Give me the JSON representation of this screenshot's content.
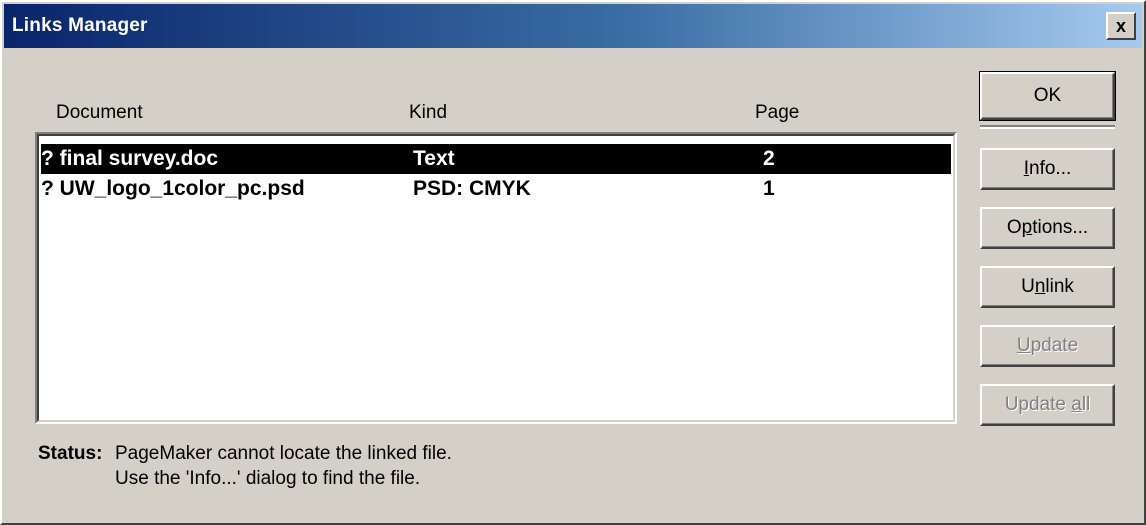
{
  "window": {
    "title": "Links Manager",
    "close_label": "x"
  },
  "columns": {
    "document": "Document",
    "kind": "Kind",
    "page": "Page"
  },
  "rows": [
    {
      "document": "? final survey.doc",
      "kind": "Text",
      "page": "2",
      "selected": true
    },
    {
      "document": "? UW_logo_1color_pc.psd",
      "kind": "PSD: CMYK",
      "page": "1",
      "selected": false
    }
  ],
  "buttons": {
    "ok": "OK",
    "info": {
      "pre": "",
      "key": "I",
      "post": "nfo..."
    },
    "options": {
      "pre": "O",
      "key": "p",
      "post": "tions..."
    },
    "unlink": {
      "pre": "U",
      "key": "n",
      "post": "link"
    },
    "update": {
      "pre": "",
      "key": "U",
      "post": "pdate"
    },
    "update_all": {
      "pre": "Update ",
      "key": "a",
      "post": "ll"
    }
  },
  "status": {
    "label": "Status:",
    "line1": "PageMaker cannot locate the linked file.",
    "line2": "Use the 'Info...' dialog to find the file."
  },
  "colors": {
    "dialog_bg": "#d4d0c8",
    "title_start": "#0a246a",
    "title_end": "#a6caf0",
    "selection": "#000000"
  }
}
